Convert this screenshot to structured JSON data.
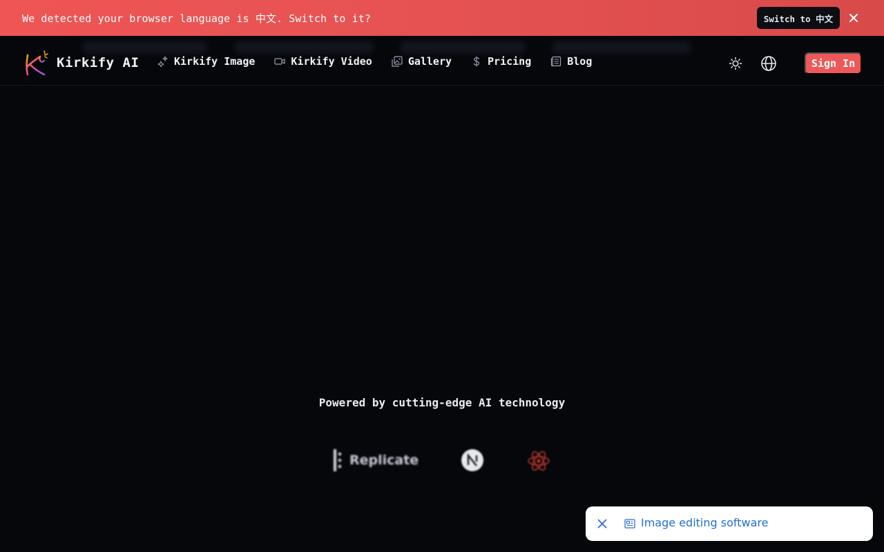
{
  "banner": {
    "message": "We detected your browser language is 中文. Switch to it?",
    "switch_label": "Switch to 中文",
    "close_icon": "close-icon"
  },
  "header": {
    "brand": "Kirkify AI",
    "nav": [
      {
        "label": "Kirkify Image",
        "icon": "sparkles-icon"
      },
      {
        "label": "Kirkify Video",
        "icon": "video-camera-icon"
      },
      {
        "label": "Gallery",
        "icon": "images-icon"
      },
      {
        "label": "Pricing",
        "icon": "dollar-icon"
      },
      {
        "label": "Blog",
        "icon": "newspaper-icon"
      }
    ],
    "theme_icon": "sun-icon",
    "language_icon": "globe-icon",
    "signin_label": "Sign In"
  },
  "main": {
    "powered_text": "Powered by cutting-edge AI technology",
    "tech_logos": [
      "Replicate",
      "Next.js",
      "React"
    ]
  },
  "toast": {
    "text": "Image editing software",
    "icon": "newspaper-icon"
  },
  "colors": {
    "background": "#05070b",
    "banner": "#ef5555",
    "accent": "#ef5858",
    "toast_text": "#1f6fc9"
  }
}
